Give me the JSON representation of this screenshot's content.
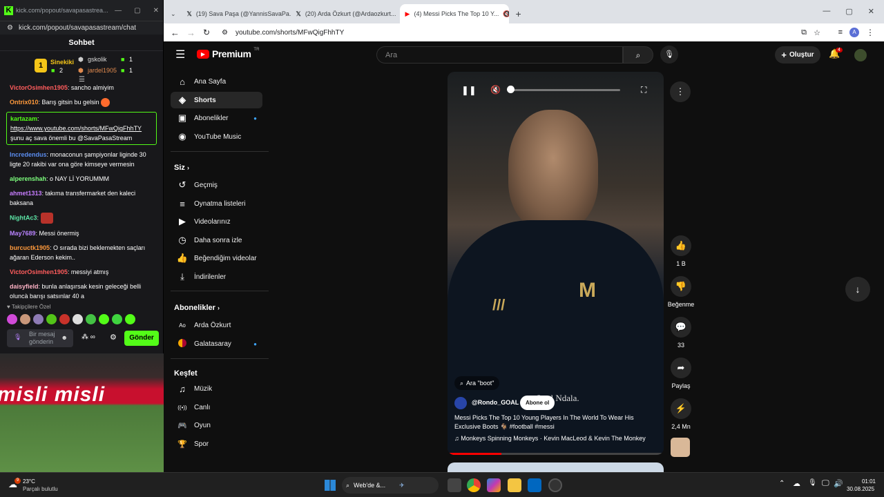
{
  "kick": {
    "window_title": "kick.com/popout/savapasastrea...",
    "url": "kick.com/popout/savapasastream/chat",
    "chat_title": "Sohbet",
    "podium": {
      "first": {
        "name": "Sinekiki",
        "count": "2"
      },
      "second": {
        "name": "gskolik",
        "count": "1"
      },
      "third": {
        "name": "jardel1905",
        "count": "1"
      }
    },
    "messages": [
      {
        "user": "VictorOsimhen1905",
        "color": "#ff5c5c",
        "text": ": sancho almiyim"
      },
      {
        "user": "Ontrix010",
        "color": "#ff9a3c",
        "text": ": Barış gitsin bu gelsin"
      },
      {
        "user": "kartazam",
        "color": "#53fc18",
        "text": ":",
        "link": "https://www.youtube.com/shorts/MFwQigFhhTY",
        "extra": "şunu aç sava önemli bu @SavaPasaStream"
      },
      {
        "user": "Incredendus",
        "color": "#5b8def",
        "text": ": monaconun şampiyonlar liginde 30 ligte 20 rakibi var ona göre kimseye vermesin"
      },
      {
        "user": "alperenshah",
        "color": "#7dff7d",
        "text": ": o NAY Lİ YORUMMM"
      },
      {
        "user": "ahmet1313",
        "color": "#c77dff",
        "text": ": takıma transfermarket den kaleci baksana"
      },
      {
        "user": "NightAc3",
        "color": "#5de8a8",
        "text": ":"
      },
      {
        "user": "May7689",
        "color": "#b983ff",
        "text": ": Messi önermiş"
      },
      {
        "user": "burcuctk1905",
        "color": "#ff9a3c",
        "text": ": O sırada bizi beklemekten saçları ağaran Ederson kekim.."
      },
      {
        "user": "VictorOsimhen1905",
        "color": "#ff5c5c",
        "text": ": messiyi atmış"
      },
      {
        "user": "daisyfield",
        "color": "#ffb3c6",
        "text": ": bunla anlaşırsak kesin geleceği belli oluncà barışı satsınlar 40 a"
      }
    ],
    "followers_label": "♥ Takipçilere Özel",
    "input_placeholder": "Bir mesaj gönderin",
    "send_label": "Gönder",
    "stadium_banner": "misli misli"
  },
  "browser": {
    "tabs": [
      {
        "label": "(19) Sava Paşa (@YannisSavaPa..."
      },
      {
        "label": "(20) Arda Özkurt (@Ardaozkurt..."
      },
      {
        "label": "(4) Messi Picks The Top 10 Y..."
      }
    ],
    "url": "youtube.com/shorts/MFwQigFhhTY"
  },
  "youtube": {
    "logo": "Premium",
    "logo_sup": "TR",
    "search_placeholder": "Ara",
    "create_label": "Oluştur",
    "notif_count": "4",
    "nav": [
      {
        "label": "Ana Sayfa",
        "icon": "⌂"
      },
      {
        "label": "Shorts",
        "icon": "◈"
      },
      {
        "label": "Abonelikler",
        "icon": "▣"
      },
      {
        "label": "YouTube Music",
        "icon": "◉"
      }
    ],
    "siz_label": "Siz",
    "siz_items": [
      {
        "label": "Geçmiş",
        "icon": "↺"
      },
      {
        "label": "Oynatma listeleri",
        "icon": "≡"
      },
      {
        "label": "Videolarınız",
        "icon": "▶"
      },
      {
        "label": "Daha sonra izle",
        "icon": "◷"
      },
      {
        "label": "Beğendiğim videolar",
        "icon": "👍"
      },
      {
        "label": "İndirilenler",
        "icon": "⤓"
      }
    ],
    "subs_label": "Abonelikler",
    "subs": [
      {
        "label": "Arda Özkurt"
      },
      {
        "label": "Galatasaray"
      }
    ],
    "explore_label": "Keşfet",
    "explore": [
      {
        "label": "Müzik",
        "icon": "♫"
      },
      {
        "label": "Canlı",
        "icon": "((•))"
      },
      {
        "label": "Oyun",
        "icon": "🎮"
      },
      {
        "label": "Spor",
        "icon": "🏆"
      }
    ],
    "short": {
      "search_chip": "Ara \"boot\"",
      "channel": "@Rondo_GOAL",
      "subscribe": "Abone ol",
      "title": "Messi Picks The Top 10 Young Players In The World To Wear His Exclusive Boots 🐐 #football #messi",
      "music": "♫ Monkeys Spinning Monkeys · Kevin MacLeod & Kevin The Monkey",
      "overlay_signature": "Leal Ndala."
    },
    "actions": {
      "like_count": "1 B",
      "dislike_label": "Beğenme",
      "comments_count": "33",
      "share_label": "Paylaş",
      "remix_count": "2,4 Mn"
    }
  },
  "taskbar": {
    "weather_temp": "23°C",
    "weather_desc": "Parçalı bulutlu",
    "search_label": "Web'de &...",
    "time": "01:01",
    "date": "30.08.2025"
  }
}
